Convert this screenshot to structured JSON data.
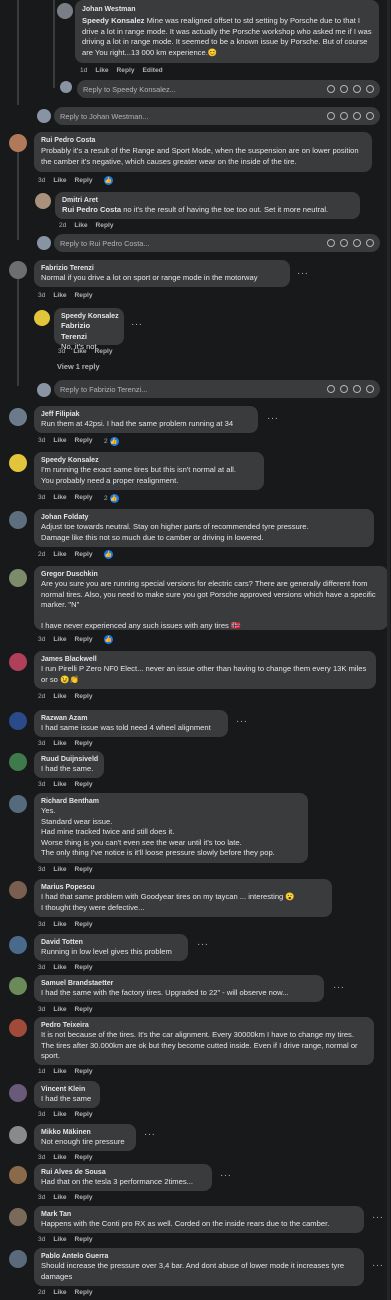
{
  "reply_placeholders": {
    "r1": "Reply to Speedy Konsalez...",
    "r2": "Reply to Johan Westman...",
    "r3": "Reply to Rui Pedro Costa...",
    "r4": "Reply to Fabrizio Terenzi..."
  },
  "view_replies": "View 1 reply",
  "actions": {
    "like": "Like",
    "reply": "Reply",
    "edited": "Edited"
  },
  "comments": [
    {
      "name": "Johan Westman",
      "text": ""
    },
    {
      "name": "Speedy Konsalez",
      "text": "Mine was realigned offset to std setting by Porsche due to that I drive a lot in range mode. It was actually the Porsche workshop who asked me if I was driving a lot in range mode. It seemed to be a known issue by Porsche. But of course are You right...13 000 km experience.",
      "emoji": "😊",
      "time": "1d"
    },
    {
      "name": "Rui Pedro Costa",
      "text": "Probably it's a result of the Range and Sport Mode, when the suspension are on lower position the camber it's negative, which causes greater wear on the inside of the tire.",
      "time": "3d"
    },
    {
      "name": "Dmitri Aret",
      "mention": "Rui Pedro Costa",
      "text": "no it's the result of having the toe too out. Set it more neutral.",
      "time": "2d"
    },
    {
      "name": "Fabrizio Terenzi",
      "text": "Normal if you drive a lot on sport or range mode in the motorway",
      "time": "3d"
    },
    {
      "name": "Speedy Konsalez",
      "mention": "Fabrizio Terenzi",
      "text": "No, it's not.",
      "time": "3d"
    },
    {
      "name": "Jeff Filipiak",
      "text": "Run them at 42psi. I had the same problem running at 34",
      "time": "3d",
      "reacts": "2"
    },
    {
      "name": "Speedy Konsalez",
      "text": "I'm running the exact same tires but this isn't normal at all.\nYou probably need a proper realignment.",
      "time": "3d",
      "reacts": "2"
    },
    {
      "name": "Johan Foldaty",
      "text": "Adjust toe towards neutral. Stay on higher parts of recommended tyre pressure.\nDamage like this not so much due to camber or driving in lowered.",
      "time": "2d"
    },
    {
      "name": "Gregor Duschkin",
      "text": "Are you sure you are running special versions for electric cars? There are generally different from normal tires. Also, you need to make sure you got Porsche approved versions which have a specific marker. \"N\"\n\nI have never experienced any such issues with any tires",
      "emoji": "🇳🇴",
      "time": "3d"
    },
    {
      "name": "James Blackwell",
      "text": "I run Pirelli P Zero NF0 Elect... never an issue other than having to change them every 13K miles or so",
      "emoji": "😉👏",
      "time": "2d"
    },
    {
      "name": "Razwan Azam",
      "text": "I had same issue was told need 4 wheel alignment",
      "time": "3d"
    },
    {
      "name": "Ruud Duijnsiveld",
      "text": "I had the same.",
      "time": "3d"
    },
    {
      "name": "Richard Bentham",
      "text": "Yes.\nStandard wear issue.\nHad mine tracked twice and still does it.\nWorse thing is you can't even see the wear until it's too late.\nThe only thing I've notice is it'll loose pressure slowly before they pop.",
      "time": "3d"
    },
    {
      "name": "Marius Popescu",
      "text": "I had that same problem with Goodyear tires on my taycan ... interesting",
      "line2": "I thought they were defective...",
      "emoji": "😮",
      "time": "3d"
    },
    {
      "name": "David Totten",
      "text": "Running in low level gives this problem",
      "time": "3d"
    },
    {
      "name": "Samuel Brandstaetter",
      "text": "I had the same with the factory tires. Upgraded to 22\" - will observe now...",
      "time": "3d"
    },
    {
      "name": "Pedro Teixeira",
      "text": "It is not because of the tires. It's the car alignment. Every 30000km I have to change my tires. The tires after 30.000km are ok but they become cutted inside. Even if I drive range, normal or sport.",
      "time": "1d"
    },
    {
      "name": "Vincent Klein",
      "text": "I had the same",
      "time": "3d"
    },
    {
      "name": "Mikko Mäkinen",
      "text": "Not enough tire pressure",
      "time": "3d"
    },
    {
      "name": "Rui Alves de Sousa",
      "text": "Had that on the tesla 3 performance 2times...",
      "time": "3d"
    },
    {
      "name": "Mark Tan",
      "text": "Happens with the Conti pro RX as well. Corded on the inside rears due to the camber.",
      "time": "3d"
    },
    {
      "name": "Pablo Antelo Guerra",
      "text": "Should increase the pressure over 3,4 bar. And dont abuse of lower mode it increases tyre damages",
      "time": "2d"
    }
  ],
  "colors": {
    "background": "#18191a",
    "bubble": "#3a3b3c",
    "text": "#e4e6eb",
    "muted": "#b0b3b8",
    "like_blue": "#1877f2"
  },
  "icons": [
    "like-icon",
    "more-options-icon",
    "emoji-icon",
    "gif-icon",
    "camera-icon",
    "sticker-icon"
  ]
}
